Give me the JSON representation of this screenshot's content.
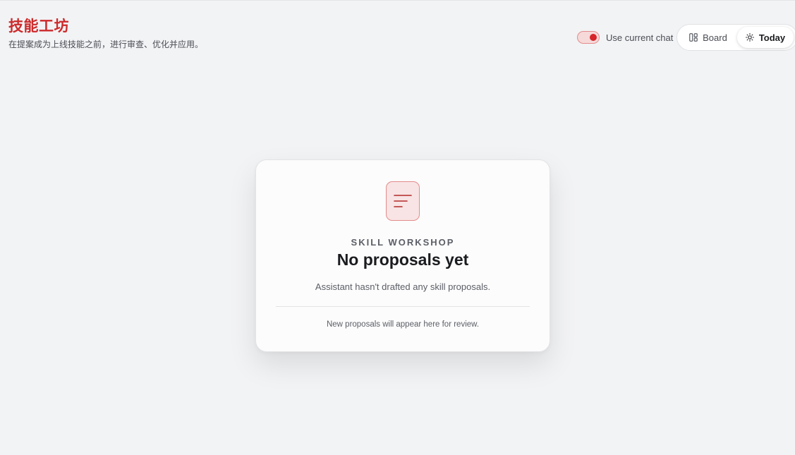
{
  "header": {
    "title": "技能工坊",
    "subtitle": "在提案成为上线技能之前，进行审查、优化并应用。"
  },
  "controls": {
    "use_current_chat": {
      "label": "Use current chat",
      "enabled": true
    },
    "view_switch": {
      "board_label": "Board",
      "today_label": "Today",
      "selected": "Today"
    }
  },
  "empty_state": {
    "eyebrow": "SKILL WORKSHOP",
    "title": "No proposals yet",
    "description": "Assistant hasn't drafted any skill proposals.",
    "footnote": "New proposals will appear here for review.",
    "icon": "lines-align-left-icon"
  },
  "colors": {
    "accent": "#cc2b2b",
    "toggle_knob": "#d6252a",
    "icon_background": "#f8e4e4",
    "page_background": "#f2f3f5"
  }
}
